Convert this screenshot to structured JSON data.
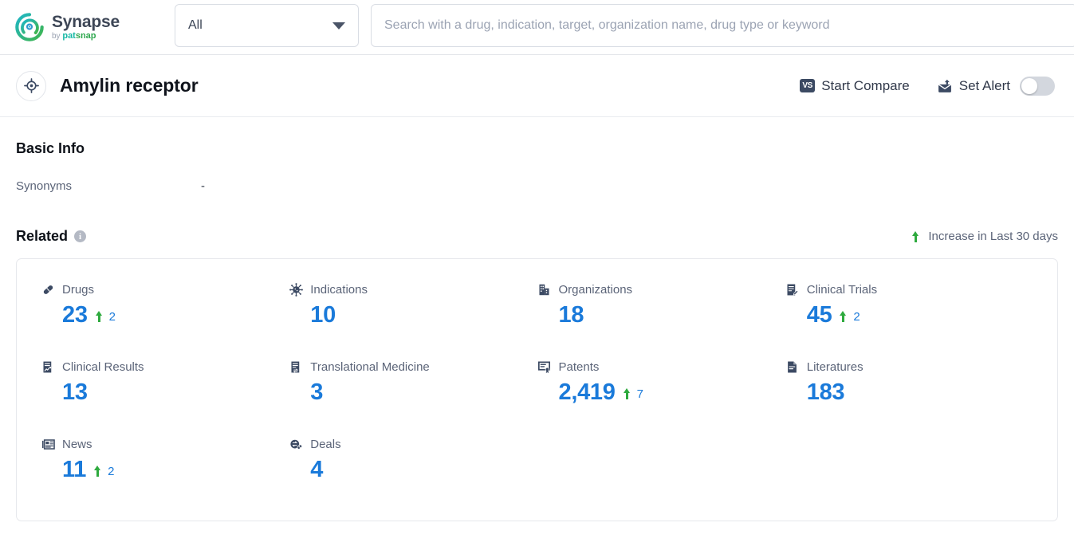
{
  "header": {
    "logo_name": "Synapse",
    "logo_by": "by ",
    "logo_pat": "pat",
    "logo_snap": "snap",
    "scope_value": "All",
    "search_placeholder": "Search with a drug, indication, target, organization name, drug type or keyword",
    "search_value": ""
  },
  "titlebar": {
    "title": "Amylin receptor",
    "start_compare": "Start Compare",
    "vs_label": "VS",
    "set_alert": "Set Alert",
    "alert_enabled": false
  },
  "basic_info": {
    "heading": "Basic Info",
    "synonyms_label": "Synonyms",
    "synonyms_value": "-"
  },
  "related": {
    "heading": "Related",
    "info_glyph": "i",
    "legend": "Increase in Last 30 days",
    "items": [
      {
        "icon": "pill-icon",
        "label": "Drugs",
        "value": "23",
        "delta": "2"
      },
      {
        "icon": "virus-icon",
        "label": "Indications",
        "value": "10",
        "delta": ""
      },
      {
        "icon": "building-icon",
        "label": "Organizations",
        "value": "18",
        "delta": ""
      },
      {
        "icon": "clinical-trial-icon",
        "label": "Clinical Trials",
        "value": "45",
        "delta": "2"
      },
      {
        "icon": "clinical-result-icon",
        "label": "Clinical Results",
        "value": "13",
        "delta": ""
      },
      {
        "icon": "translational-medicine-icon",
        "label": "Translational Medicine",
        "value": "3",
        "delta": ""
      },
      {
        "icon": "patent-icon",
        "label": "Patents",
        "value": "2,419",
        "delta": "7"
      },
      {
        "icon": "literature-icon",
        "label": "Literatures",
        "value": "183",
        "delta": ""
      },
      {
        "icon": "news-icon",
        "label": "News",
        "value": "11",
        "delta": "2"
      },
      {
        "icon": "deal-icon",
        "label": "Deals",
        "value": "4",
        "delta": ""
      }
    ]
  },
  "colors": {
    "accent_blue": "#1a7ada",
    "increase_green": "#2eaa3e",
    "icon_dark": "#3c4a63",
    "text_muted": "#5b6478"
  }
}
